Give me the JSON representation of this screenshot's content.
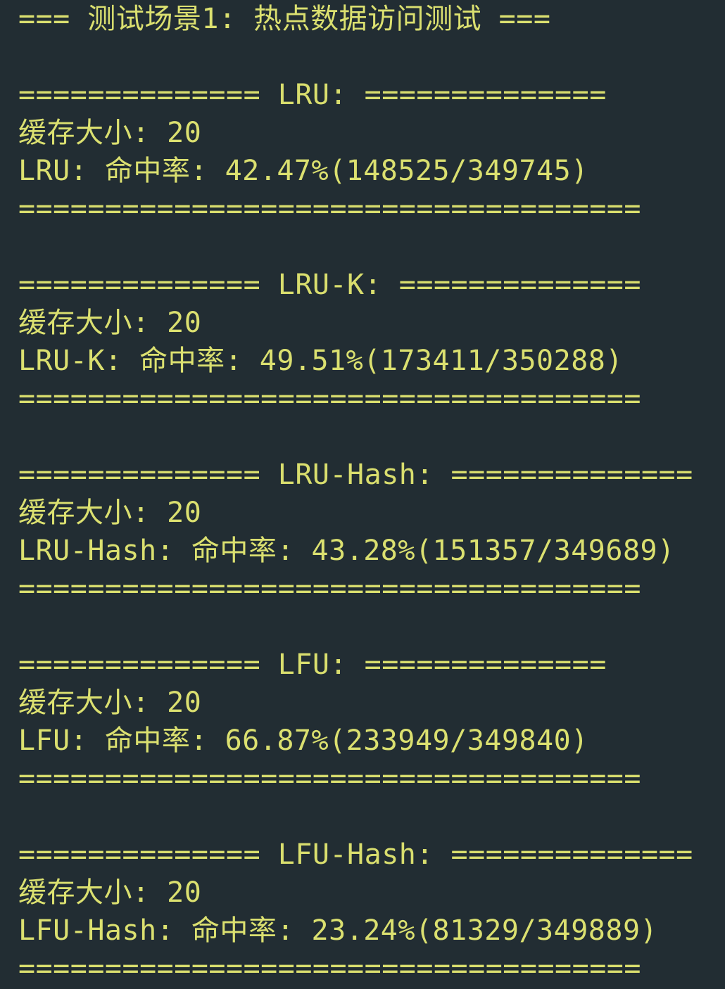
{
  "colors": {
    "background": "#222d33",
    "text": "#dbe070"
  },
  "title": "=== 测试场景1: 热点数据访问测试 ===",
  "blocks": [
    {
      "header": "============== LRU: ==============",
      "cache_size": "缓存大小: 20",
      "hit_rate": "LRU: 命中率: 42.47%(148525/349745)",
      "footer": "===================================="
    },
    {
      "header": "============== LRU-K: ==============",
      "cache_size": "缓存大小: 20",
      "hit_rate": "LRU-K: 命中率: 49.51%(173411/350288)",
      "footer": "===================================="
    },
    {
      "header": "============== LRU-Hash: ==============",
      "cache_size": "缓存大小: 20",
      "hit_rate": "LRU-Hash: 命中率: 43.28%(151357/349689)",
      "footer": "===================================="
    },
    {
      "header": "============== LFU: ==============",
      "cache_size": "缓存大小: 20",
      "hit_rate": "LFU: 命中率: 66.87%(233949/349840)",
      "footer": "===================================="
    },
    {
      "header": "============== LFU-Hash: ==============",
      "cache_size": "缓存大小: 20",
      "hit_rate": "LFU-Hash: 命中率: 23.24%(81329/349889)",
      "footer": "===================================="
    }
  ]
}
